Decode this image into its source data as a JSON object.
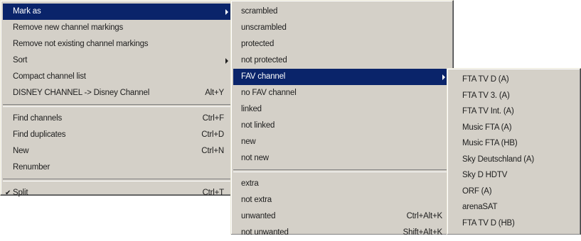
{
  "main_menu": {
    "items": [
      {
        "label": "Mark as",
        "shortcut": "",
        "submenu": true,
        "active": true
      },
      {
        "label": "Remove new channel markings",
        "shortcut": ""
      },
      {
        "label": "Remove not existing channel markings",
        "shortcut": ""
      },
      {
        "label": "Sort",
        "shortcut": "",
        "submenu": true
      },
      {
        "label": "Compact channel list",
        "shortcut": ""
      },
      {
        "label": "DISNEY CHANNEL -> Disney Channel",
        "shortcut": "Alt+Y"
      },
      {
        "label": "Find channels",
        "shortcut": "Ctrl+F"
      },
      {
        "label": "Find duplicates",
        "shortcut": "Ctrl+D"
      },
      {
        "label": "New",
        "shortcut": "Ctrl+N"
      },
      {
        "label": "Renumber",
        "shortcut": ""
      },
      {
        "label": "Split",
        "shortcut": "Ctrl+T",
        "checked": true,
        "check_glyph": "✔"
      }
    ]
  },
  "mark_as_menu": {
    "items": [
      {
        "label": "scrambled"
      },
      {
        "label": "unscrambled"
      },
      {
        "label": "protected"
      },
      {
        "label": "not protected"
      },
      {
        "label": "FAV channel",
        "submenu": true,
        "active": true
      },
      {
        "label": "no FAV channel"
      },
      {
        "label": "linked"
      },
      {
        "label": "not linked"
      },
      {
        "label": "new"
      },
      {
        "label": "not new"
      },
      {
        "label": "extra"
      },
      {
        "label": "not extra"
      },
      {
        "label": "unwanted",
        "shortcut": "Ctrl+Alt+K"
      },
      {
        "label": "not unwanted",
        "shortcut": "Shift+Alt+K"
      }
    ]
  },
  "fav_menu": {
    "items": [
      {
        "label": "FTA TV D (A)"
      },
      {
        "label": "FTA TV 3. (A)"
      },
      {
        "label": "FTA TV Int. (A)"
      },
      {
        "label": "Music FTA (A)"
      },
      {
        "label": "Music FTA (HB)"
      },
      {
        "label": "Sky Deutschland (A)"
      },
      {
        "label": "Sky D HDTV"
      },
      {
        "label": "ORF (A)"
      },
      {
        "label": "arenaSAT"
      },
      {
        "label": "FTA TV D (HB)"
      }
    ]
  },
  "colors": {
    "menu_bg": "#d4d0c8",
    "highlight": "#0a246a",
    "highlight_text": "#ffffff",
    "text": "#202020"
  }
}
